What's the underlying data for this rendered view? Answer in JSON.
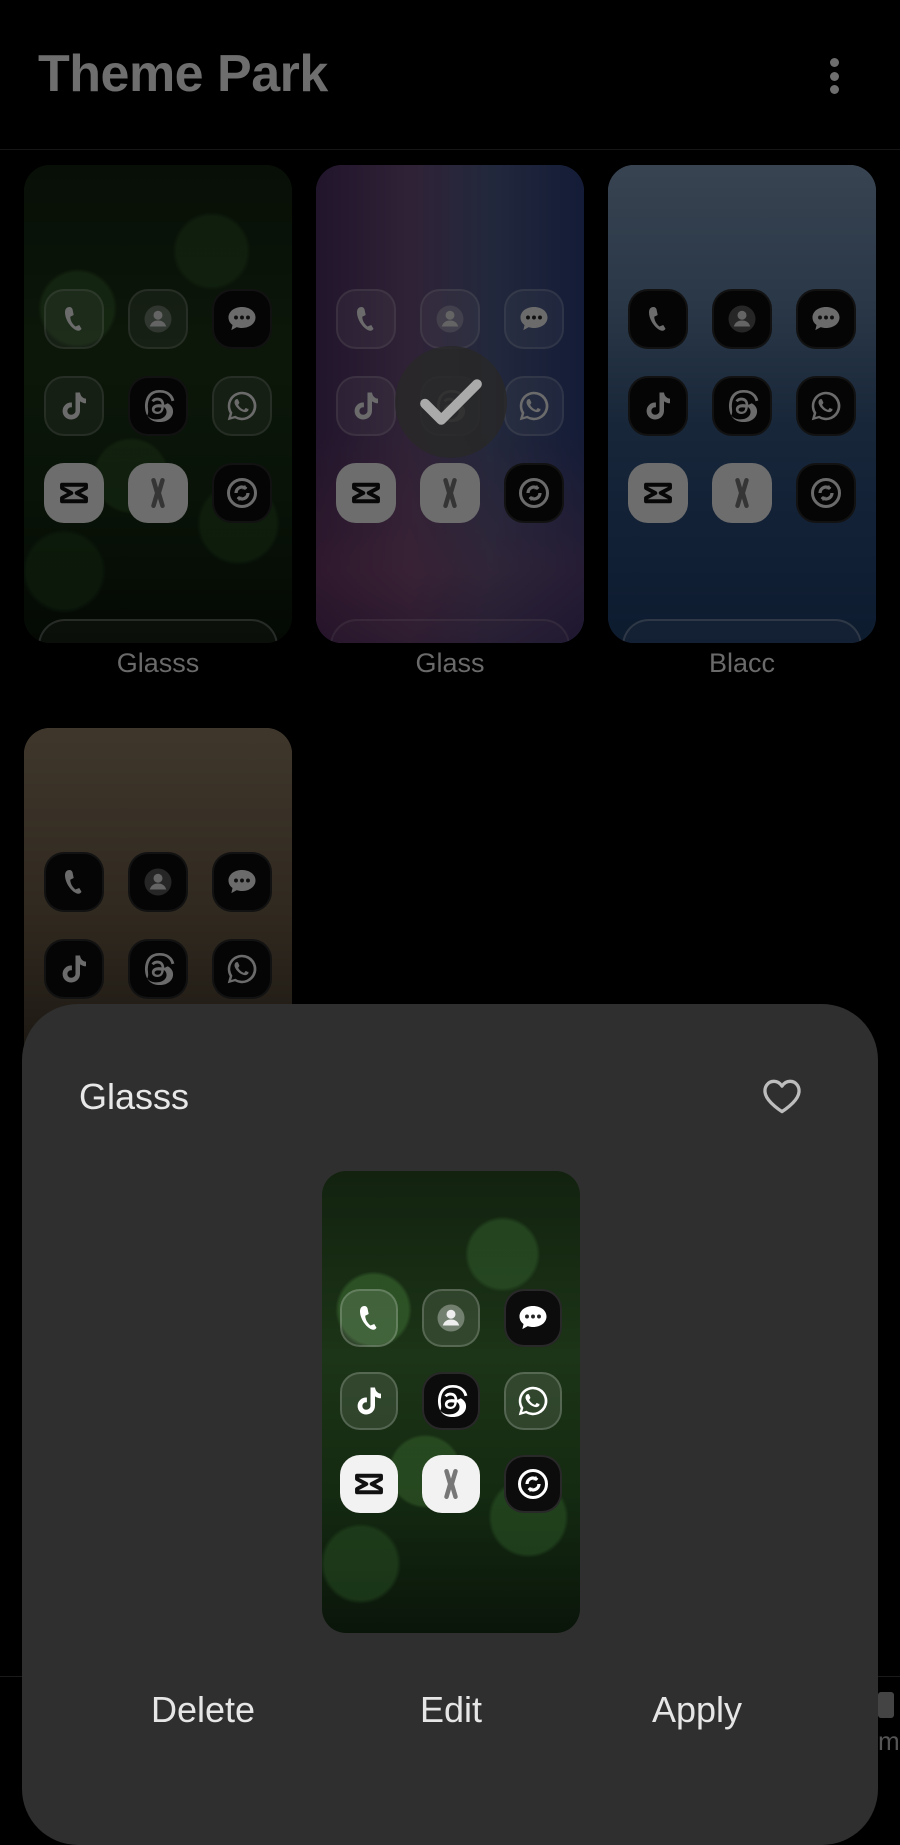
{
  "header": {
    "title": "Theme Park",
    "more_icon": "more-vertical-icon"
  },
  "themes": [
    {
      "name": "Glasss",
      "style": "glass",
      "wallpaper": "green-foliage"
    },
    {
      "name": "Glass",
      "style": "glass",
      "wallpaper": "purple-blue-gradient",
      "applied": true
    },
    {
      "name": "Blacc",
      "style": "black",
      "wallpaper": "blue-water"
    },
    {
      "name": "",
      "style": "black",
      "wallpaper": "tan-beige"
    }
  ],
  "sheet": {
    "title": "Glasss",
    "favorite_icon": "heart-outline-icon",
    "actions": {
      "delete": "Delete",
      "edit": "Edit",
      "apply": "Apply"
    }
  },
  "bottom_nav_peek": {
    "text": "m"
  },
  "colors": {
    "background": "#000000",
    "sheet": "#2f2f2f",
    "title": "#6e6e6e",
    "action_text": "#e6e6e6"
  }
}
